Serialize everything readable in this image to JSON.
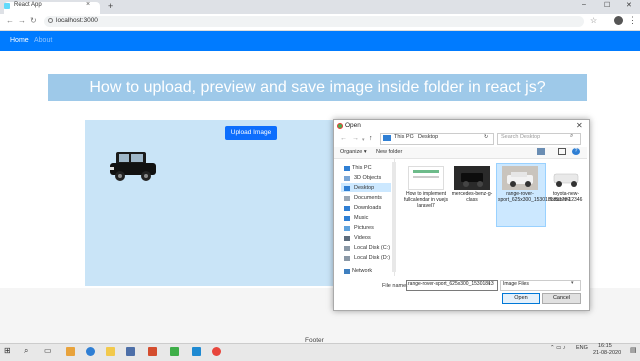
{
  "browser": {
    "tab_title": "React App",
    "tab_close": "×",
    "new_tab": "+",
    "url": "localhost:3000",
    "min": "–",
    "max": "☐",
    "close": "✕"
  },
  "navbar": {
    "home": "Home",
    "about": "About",
    "color": "#007bff"
  },
  "page": {
    "title": "How to upload, preview and save image inside folder in react js?",
    "upload_button": "Upload Image",
    "footer": "Footer"
  },
  "dialog": {
    "title": "Open",
    "path": [
      "This PC",
      "Desktop"
    ],
    "search_placeholder": "Search Desktop",
    "organize": "Organize ▾",
    "new_folder": "New folder",
    "sidebar": [
      "This PC",
      "3D Objects",
      "Desktop",
      "Documents",
      "Downloads",
      "Music",
      "Pictures",
      "Videos",
      "Local Disk (C:)",
      "Local Disk (D:)",
      "Network"
    ],
    "files": [
      {
        "name": "How to implement fullcalendar in vuejs laravel7"
      },
      {
        "name": "mercedes-benz-g-class"
      },
      {
        "name": "range-rover-sport_625x300_1530181391799"
      },
      {
        "name": "toyota-new-fortuner-12346"
      }
    ],
    "file_name_label": "File name:",
    "file_name_value": "range-rover-sport_625x300_1530181391799",
    "file_type": "Image Files",
    "open_button": "Open",
    "cancel_button": "Cancel"
  },
  "taskbar": {
    "time": "16:15",
    "date": "21-08-2020",
    "lang": "ENG"
  }
}
